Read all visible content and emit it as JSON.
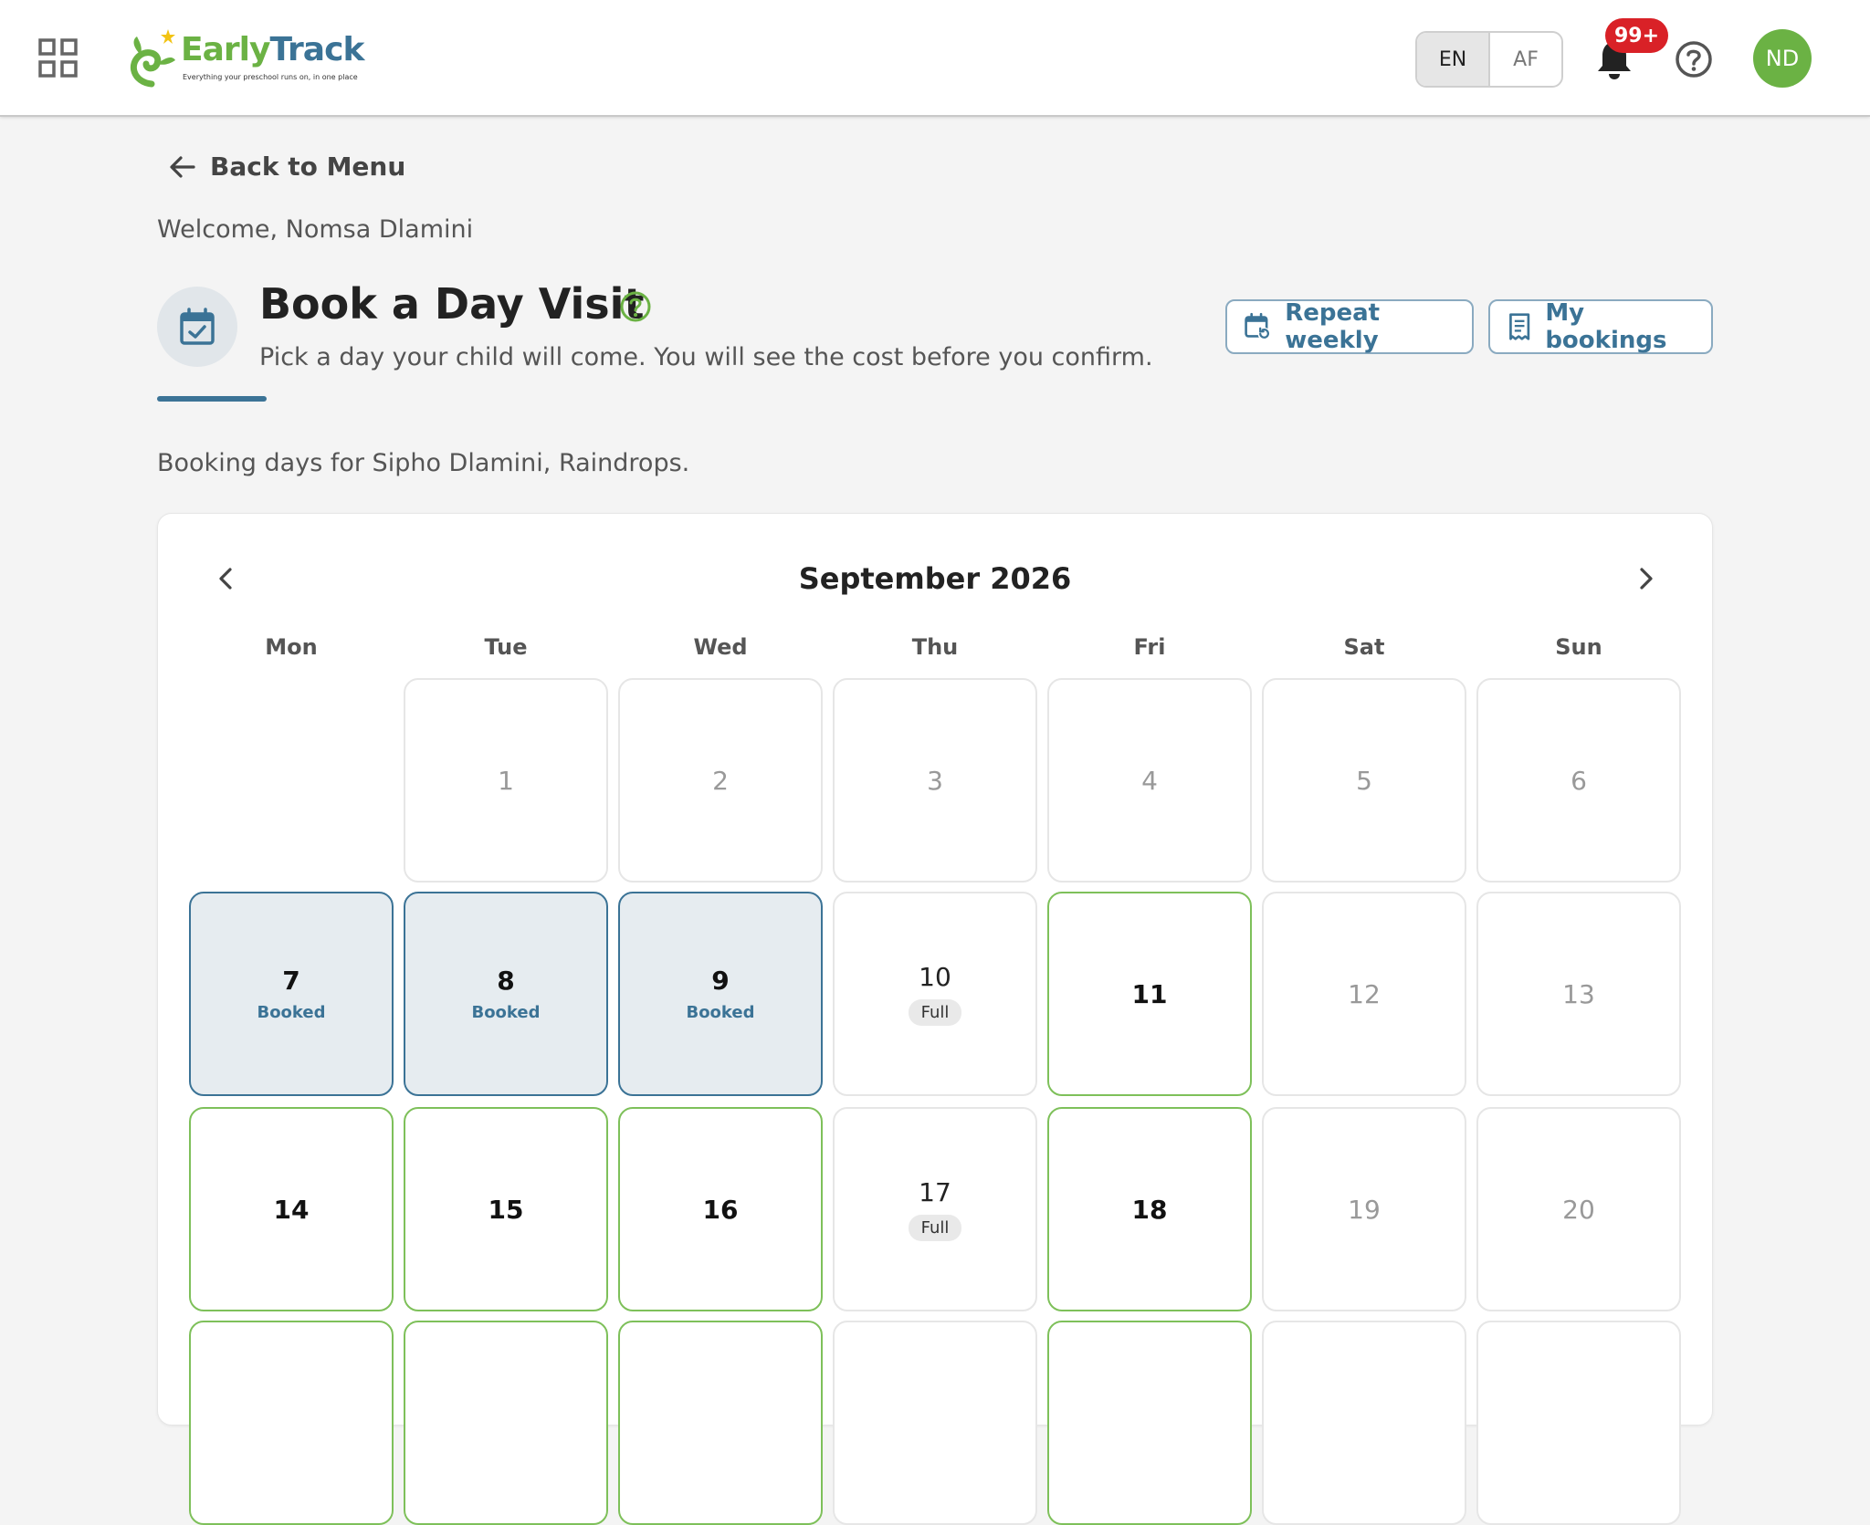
{
  "header": {
    "logo_part1": "Early",
    "logo_part2": "Track",
    "logo_tagline": "Everything your preschool runs on, in one place",
    "languages": [
      "EN",
      "AF"
    ],
    "active_language": "EN",
    "notifications_badge": "99+",
    "avatar_initials": "ND",
    "colors": {
      "brand_green": "#6bb244",
      "brand_blue": "#3b7396",
      "badge_red": "#d92127"
    }
  },
  "page": {
    "back_label": "Back to Menu",
    "welcome": "Welcome, Nomsa Dlamini",
    "title": "Book a Day Visit",
    "subtitle": "Pick a day your child will come. You will see the cost before you confirm.",
    "repeat_weekly_label": "Repeat weekly",
    "my_bookings_label": "My bookings",
    "booking_for": "Booking days for Sipho Dlamini, Raindrops."
  },
  "calendar": {
    "month_label": "September 2026",
    "weekdays": [
      "Mon",
      "Tue",
      "Wed",
      "Thu",
      "Fri",
      "Sat",
      "Sun"
    ],
    "first_weekday_index": 1,
    "days": [
      {
        "day": "1",
        "state": "unavailable"
      },
      {
        "day": "2",
        "state": "unavailable"
      },
      {
        "day": "3",
        "state": "unavailable"
      },
      {
        "day": "4",
        "state": "unavailable"
      },
      {
        "day": "5",
        "state": "unavailable"
      },
      {
        "day": "6",
        "state": "unavailable"
      },
      {
        "day": "7",
        "state": "booked",
        "status": "Booked"
      },
      {
        "day": "8",
        "state": "booked",
        "status": "Booked"
      },
      {
        "day": "9",
        "state": "booked",
        "status": "Booked"
      },
      {
        "day": "10",
        "state": "full",
        "status": "Full"
      },
      {
        "day": "11",
        "state": "available"
      },
      {
        "day": "12",
        "state": "unavailable"
      },
      {
        "day": "13",
        "state": "unavailable"
      },
      {
        "day": "14",
        "state": "available"
      },
      {
        "day": "15",
        "state": "available"
      },
      {
        "day": "16",
        "state": "available"
      },
      {
        "day": "17",
        "state": "full",
        "status": "Full"
      },
      {
        "day": "18",
        "state": "available"
      },
      {
        "day": "19",
        "state": "unavailable"
      },
      {
        "day": "20",
        "state": "unavailable"
      },
      {
        "day": "",
        "state": "available"
      },
      {
        "day": "",
        "state": "available"
      },
      {
        "day": "",
        "state": "available"
      },
      {
        "day": "",
        "state": "unavailable"
      },
      {
        "day": "",
        "state": "available"
      },
      {
        "day": "",
        "state": "unavailable"
      },
      {
        "day": "",
        "state": "unavailable"
      }
    ]
  }
}
